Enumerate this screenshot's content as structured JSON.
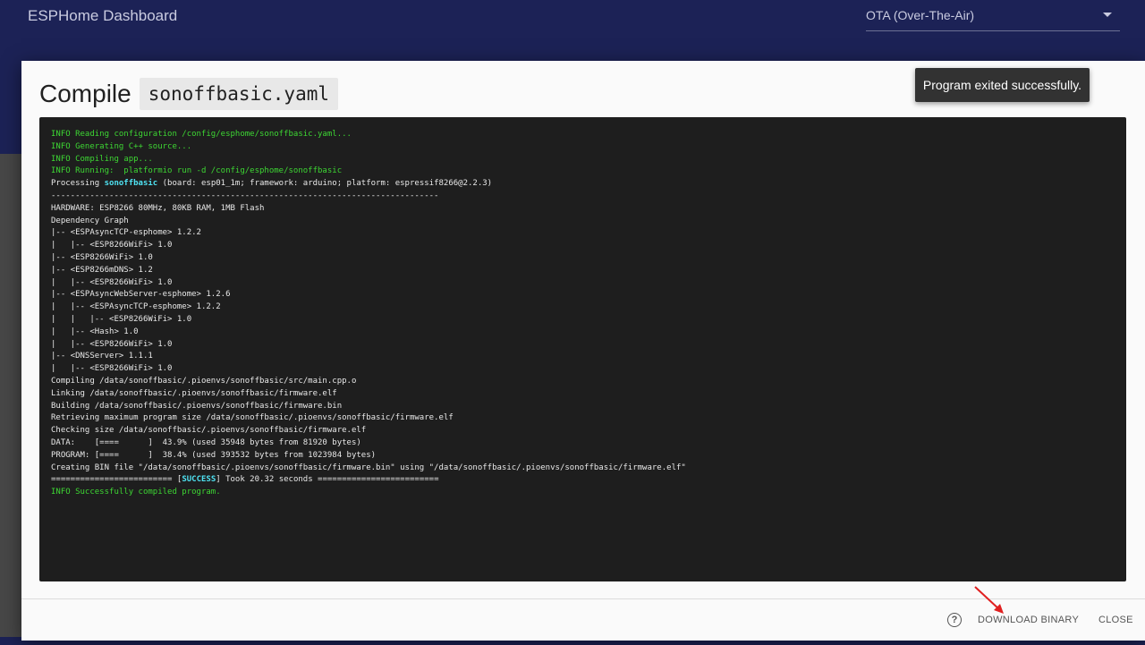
{
  "header": {
    "app_title": "ESPHome Dashboard",
    "upload_method": "OTA (Over-The-Air)"
  },
  "dialog": {
    "title": "Compile",
    "filename": "sonoffbasic.yaml",
    "toast": "Program exited successfully.",
    "log": [
      {
        "text": "INFO Reading configuration /config/esphome/sonoffbasic.yaml...",
        "color": "green"
      },
      {
        "text": "INFO Generating C++ source...",
        "color": "green"
      },
      {
        "text": "INFO Compiling app...",
        "color": "green"
      },
      {
        "text": "INFO Running:  platformio run -d /config/esphome/sonoffbasic",
        "color": "green"
      },
      {
        "parts": [
          {
            "t": "Processing "
          },
          {
            "t": "sonoffbasic",
            "c": "cyan"
          },
          {
            "t": " (board: esp01_1m; framework: arduino; platform: espressif8266@2.2.3)"
          }
        ]
      },
      {
        "text": "--------------------------------------------------------------------------------"
      },
      {
        "text": "HARDWARE: ESP8266 80MHz, 80KB RAM, 1MB Flash"
      },
      {
        "text": "Dependency Graph"
      },
      {
        "text": "|-- <ESPAsyncTCP-esphome> 1.2.2"
      },
      {
        "text": "|   |-- <ESP8266WiFi> 1.0"
      },
      {
        "text": "|-- <ESP8266WiFi> 1.0"
      },
      {
        "text": "|-- <ESP8266mDNS> 1.2"
      },
      {
        "text": "|   |-- <ESP8266WiFi> 1.0"
      },
      {
        "text": "|-- <ESPAsyncWebServer-esphome> 1.2.6"
      },
      {
        "text": "|   |-- <ESPAsyncTCP-esphome> 1.2.2"
      },
      {
        "text": "|   |   |-- <ESP8266WiFi> 1.0"
      },
      {
        "text": "|   |-- <Hash> 1.0"
      },
      {
        "text": "|   |-- <ESP8266WiFi> 1.0"
      },
      {
        "text": "|-- <DNSServer> 1.1.1"
      },
      {
        "text": "|   |-- <ESP8266WiFi> 1.0"
      },
      {
        "text": "Compiling /data/sonoffbasic/.pioenvs/sonoffbasic/src/main.cpp.o"
      },
      {
        "text": "Linking /data/sonoffbasic/.pioenvs/sonoffbasic/firmware.elf"
      },
      {
        "text": "Building /data/sonoffbasic/.pioenvs/sonoffbasic/firmware.bin"
      },
      {
        "text": "Retrieving maximum program size /data/sonoffbasic/.pioenvs/sonoffbasic/firmware.elf"
      },
      {
        "text": "Checking size /data/sonoffbasic/.pioenvs/sonoffbasic/firmware.elf"
      },
      {
        "text": "DATA:    [====      ]  43.9% (used 35948 bytes from 81920 bytes)"
      },
      {
        "text": "PROGRAM: [====      ]  38.4% (used 393532 bytes from 1023984 bytes)"
      },
      {
        "text": "Creating BIN file \"/data/sonoffbasic/.pioenvs/sonoffbasic/firmware.bin\" using \"/data/sonoffbasic/.pioenvs/sonoffbasic/firmware.elf\""
      },
      {
        "parts": [
          {
            "t": "========================= ["
          },
          {
            "t": "SUCCESS",
            "c": "cyan"
          },
          {
            "t": "] Took 20.32 seconds ========================="
          }
        ]
      },
      {
        "text": "INFO Successfully compiled program.",
        "color": "green"
      }
    ],
    "buttons": {
      "download": "DOWNLOAD BINARY",
      "close": "CLOSE"
    },
    "help_icon_glyph": "?",
    "icons": {
      "help": "help-circle-icon",
      "annotation": "red-arrow-icon"
    },
    "colors": {
      "header": "#1c2256",
      "console_bg": "#1e1e1e",
      "info_green": "#3dd633",
      "highlight_cyan": "#4fe3f3",
      "annotation_red": "#e02020"
    }
  }
}
